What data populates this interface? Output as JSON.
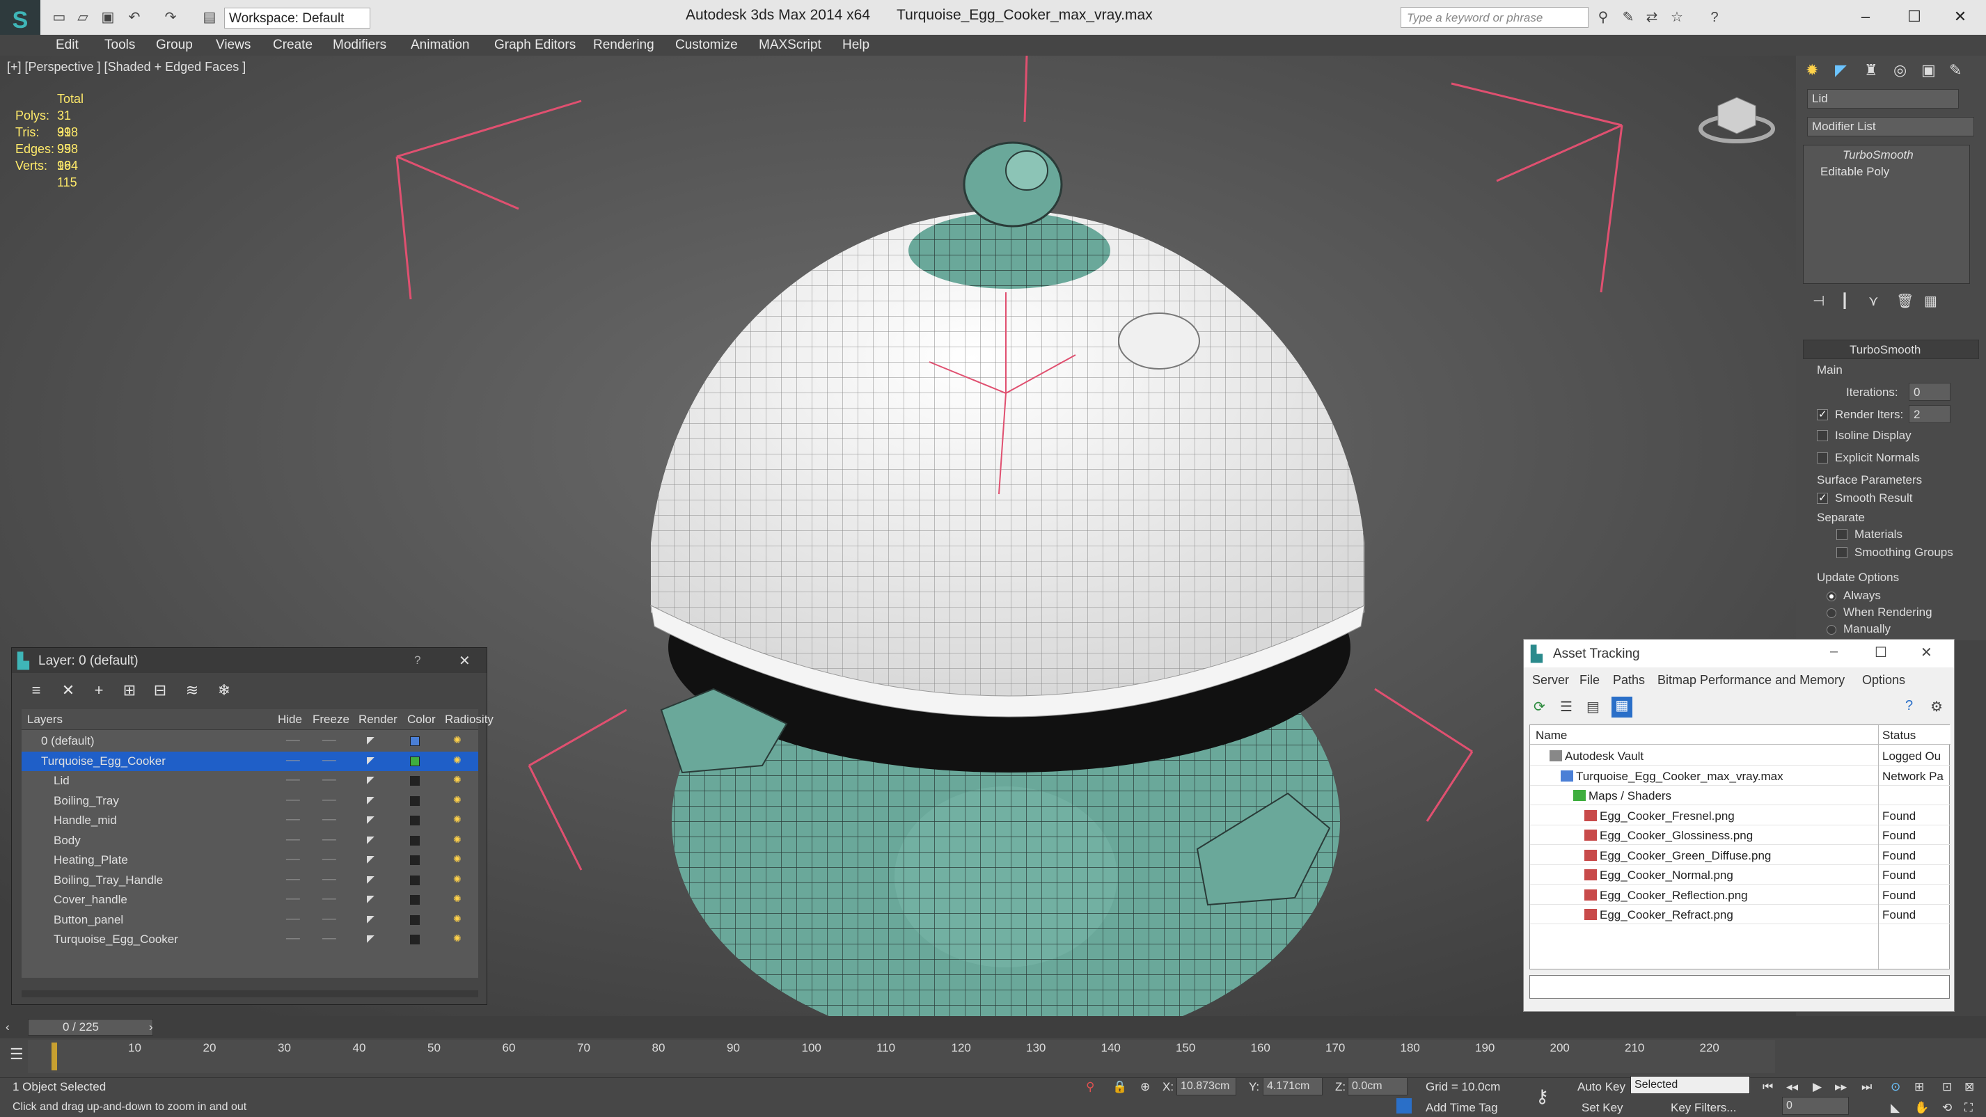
{
  "app": {
    "title": "Autodesk 3ds Max  2014 x64",
    "file": "Turquoise_Egg_Cooker_max_vray.max",
    "workspace": "Workspace: Default",
    "search_placeholder": "Type a keyword or phrase"
  },
  "menu": [
    "Edit",
    "Tools",
    "Group",
    "Views",
    "Create",
    "Modifiers",
    "Animation",
    "Graph Editors",
    "Rendering",
    "Customize",
    "MAXScript",
    "Help"
  ],
  "viewport": {
    "label": "[+] [Perspective ] [Shaded + Edged Faces ]",
    "stats": {
      "header": "Total",
      "rows": [
        {
          "k": "Polys:",
          "v": "31 998"
        },
        {
          "k": "Tris:",
          "v": "31 998"
        },
        {
          "k": "Edges:",
          "v": "95 994"
        },
        {
          "k": "Verts:",
          "v": "16 115"
        }
      ]
    }
  },
  "command_panel": {
    "object_name": "Lid",
    "modifier_list": "Modifier List",
    "stack": [
      "TurboSmooth",
      "Editable Poly"
    ],
    "rollout": "TurboSmooth",
    "main": "Main",
    "iterations_label": "Iterations:",
    "iterations": "0",
    "render_iters_label": "Render Iters:",
    "render_iters": "2",
    "isoline": "Isoline Display",
    "explicit": "Explicit Normals",
    "surface": "Surface Parameters",
    "smooth": "Smooth Result",
    "separate": "Separate",
    "materials": "Materials",
    "smoothing_groups": "Smoothing Groups",
    "update": "Update Options",
    "always": "Always",
    "when_rendering": "When Rendering",
    "manually": "Manually"
  },
  "layer": {
    "title": "Layer: 0 (default)",
    "help": "?",
    "close": "✕",
    "cols": [
      "Layers",
      "Hide",
      "Freeze",
      "Render",
      "Color",
      "Radiosity"
    ],
    "rows": [
      {
        "name": "0 (default)",
        "color": "#4a7fd6"
      },
      {
        "name": "Turquoise_Egg_Cooker",
        "color": "#3fae3f"
      },
      {
        "name": "Lid",
        "color": "#222222"
      },
      {
        "name": "Boiling_Tray",
        "color": "#222222"
      },
      {
        "name": "Handle_mid",
        "color": "#222222"
      },
      {
        "name": "Body",
        "color": "#222222"
      },
      {
        "name": "Heating_Plate",
        "color": "#222222"
      },
      {
        "name": "Boiling_Tray_Handle",
        "color": "#222222"
      },
      {
        "name": "Cover_handle",
        "color": "#222222"
      },
      {
        "name": "Button_panel",
        "color": "#222222"
      },
      {
        "name": "Turquoise_Egg_Cooker",
        "color": "#222222"
      }
    ]
  },
  "asset": {
    "title": "Asset Tracking",
    "menu": [
      "Server",
      "File",
      "Paths",
      "Bitmap Performance and Memory",
      "Options"
    ],
    "col_name": "Name",
    "col_status": "Status",
    "rows": [
      {
        "name": "Autodesk Vault",
        "status": "Logged Ou"
      },
      {
        "name": "Turquoise_Egg_Cooker_max_vray.max",
        "status": "Network Pa"
      },
      {
        "name": "Maps / Shaders",
        "status": ""
      },
      {
        "name": "Egg_Cooker_Fresnel.png",
        "status": "Found"
      },
      {
        "name": "Egg_Cooker_Glossiness.png",
        "status": "Found"
      },
      {
        "name": "Egg_Cooker_Green_Diffuse.png",
        "status": "Found"
      },
      {
        "name": "Egg_Cooker_Normal.png",
        "status": "Found"
      },
      {
        "name": "Egg_Cooker_Reflection.png",
        "status": "Found"
      },
      {
        "name": "Egg_Cooker_Refract.png",
        "status": "Found"
      }
    ]
  },
  "timeline": {
    "frame": "0 / 225",
    "ticks": [
      "10",
      "20",
      "30",
      "40",
      "50",
      "60",
      "70",
      "80",
      "90",
      "100",
      "110",
      "120",
      "130",
      "140",
      "150",
      "160",
      "170",
      "180",
      "190",
      "200",
      "210",
      "220"
    ]
  },
  "status": {
    "selected": "1 Object Selected",
    "prompt": "Click and drag up-and-down to zoom in and out",
    "x_label": "X:",
    "x": "10.873cm",
    "y_label": "Y:",
    "y": "4.171cm",
    "z_label": "Z:",
    "z": "0.0cm",
    "grid": "Grid = 10.0cm",
    "add_time_tag": "Add Time Tag",
    "auto_key": "Auto Key",
    "set_key": "Set Key",
    "selected_mode": "Selected",
    "key_filters": "Key Filters...",
    "frame": "0"
  }
}
